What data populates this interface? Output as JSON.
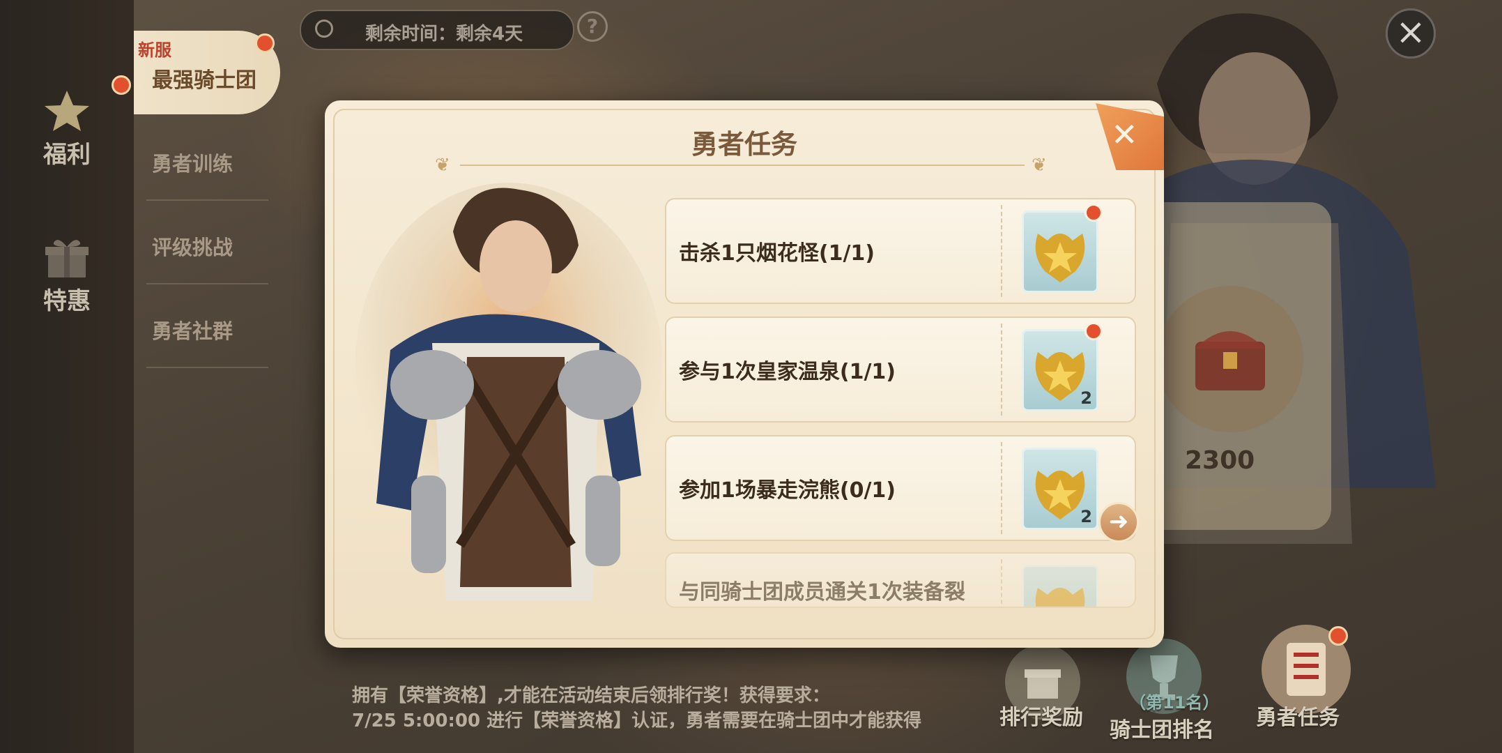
{
  "timer": {
    "text": "剩余时间：剩余4天",
    "help": "?"
  },
  "left_rail": [
    {
      "label": "福利",
      "icon": "star-icon"
    },
    {
      "label": "特惠",
      "icon": "gift-icon"
    }
  ],
  "submenu": {
    "active_tag": "新服",
    "active_label": "最强骑士团",
    "items": [
      "勇者训练",
      "评级挑战",
      "勇者社群"
    ]
  },
  "modal": {
    "title": "勇者任务",
    "tasks": [
      {
        "label": "击杀1只烟花怪(1/1)",
        "count": "",
        "has_dot": true
      },
      {
        "label": "参与1次皇家温泉(1/1)",
        "count": "2",
        "has_dot": true
      },
      {
        "label": "参加1场暴走浣熊(0/1)",
        "count": "2",
        "has_dot": false
      },
      {
        "label": "与同骑士团成员通关1次装备裂",
        "count": "",
        "has_dot": false
      }
    ]
  },
  "reward": {
    "value": "2300"
  },
  "bottom": {
    "line1": "拥有【荣誉资格】,才能在活动结束后领排行奖！获得要求：",
    "line2": "7/25 5:00:00 进行【荣誉资格】认证，勇者需要在骑士团中才能获得",
    "buttons": [
      {
        "label": "排行奖励"
      },
      {
        "label": "骑士团排名",
        "sub": "（第11名）"
      },
      {
        "label": "勇者任务"
      }
    ]
  },
  "colors": {
    "accent": "#e2502e",
    "panel": "#f6ecd8",
    "title": "#7a5a3a"
  }
}
